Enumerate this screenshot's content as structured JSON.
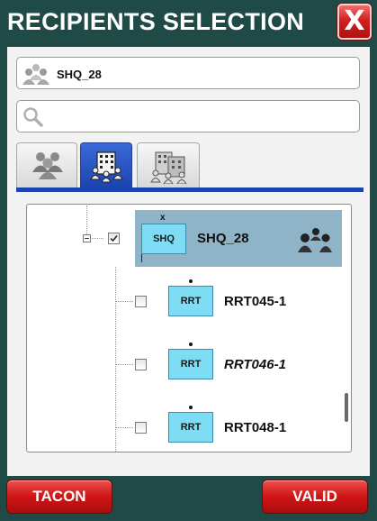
{
  "window": {
    "title": "RECIPIENTS SELECTION",
    "close_label": "X"
  },
  "selection": {
    "value": "SHQ_28",
    "icon": "group-icon"
  },
  "search": {
    "value": "",
    "placeholder": "",
    "icon": "search-icon"
  },
  "tabs": [
    {
      "name": "group-users-tab",
      "icon": "users-group-icon",
      "active": false
    },
    {
      "name": "organization-tab",
      "icon": "building-icon",
      "active": true
    },
    {
      "name": "sites-tab",
      "icon": "buildings-icon",
      "active": false
    }
  ],
  "tree": {
    "root": {
      "node_label": "SHQ",
      "name": "SHQ_28",
      "marker": "x",
      "checked": true,
      "expanded": true
    },
    "children": [
      {
        "node_label": "RRT",
        "name": "RRT045-1",
        "checked": false,
        "italic": false
      },
      {
        "node_label": "RRT",
        "name": "RRT046-1",
        "checked": false,
        "italic": true
      },
      {
        "node_label": "RRT",
        "name": "RRT048-1",
        "checked": false,
        "italic": false
      }
    ]
  },
  "buttons": {
    "cancel": "TACON",
    "confirm": "VALID"
  },
  "colors": {
    "background": "#1f4a45",
    "accent": "#1c44b0",
    "root_highlight": "#8fb4c8",
    "node_fill": "#7fdcf5",
    "button_red": "#cf1515"
  }
}
